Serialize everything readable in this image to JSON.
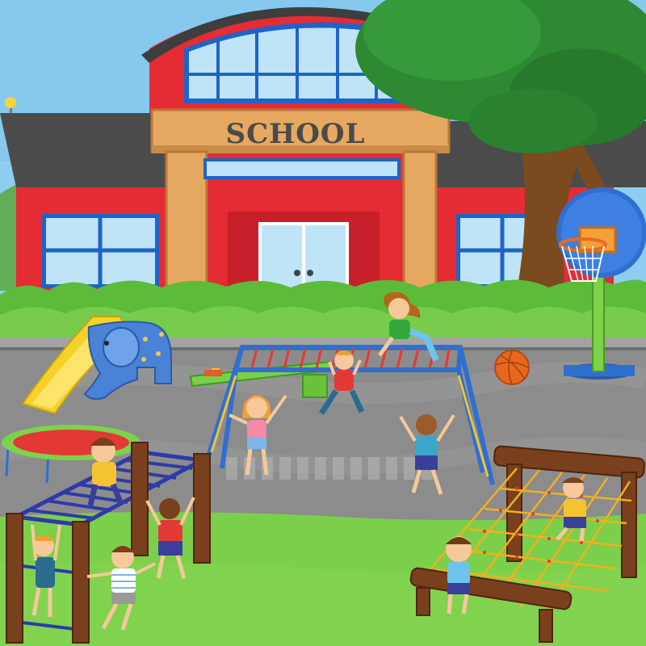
{
  "school_sign": {
    "text": "SCHOOL"
  },
  "colors": {
    "sky": "#8fcdf0",
    "building_red": "#e52b33",
    "roof_dark": "#4b4b4b",
    "trim_wood": "#e6a860",
    "window_blue": "#bfe4f7",
    "pavement": "#8c8c8c",
    "grass": "#7ccf4a",
    "tree_green": "#2e8a32",
    "hedge_green": "#5dbb3a",
    "frame_blue": "#2f6fd0",
    "wood_post": "#7a3f1c",
    "net_orange": "#f0b020"
  },
  "scene_objects": [
    "school-building",
    "school-sign",
    "tree",
    "hedge",
    "basketball-hoop",
    "basketball",
    "elephant-slide",
    "trampoline",
    "seesaw",
    "monkey-bars-left",
    "climbing-frame-center",
    "rope-net-climber",
    "children"
  ]
}
